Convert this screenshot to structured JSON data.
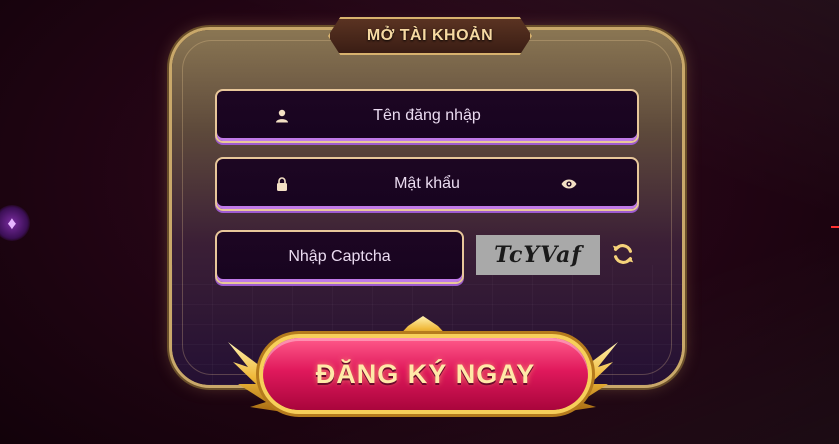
{
  "form": {
    "title": "MỞ TÀI KHOẢN",
    "username_placeholder": "Tên đăng nhập",
    "password_placeholder": "Mật khẩu",
    "captcha_placeholder": "Nhập Captcha",
    "captcha_code": "TcYVaf",
    "submit_label": "ĐĂNG KÝ NGAY"
  },
  "icons": {
    "username": "user-icon",
    "password": "lock-icon",
    "toggle_password": "eye-icon",
    "refresh_captcha": "refresh-icon",
    "side": "diamond-icon"
  },
  "colors": {
    "accent_gold": "#e8c79a",
    "cta_pink": "#e0195c",
    "field_bg": "#1d0622"
  }
}
